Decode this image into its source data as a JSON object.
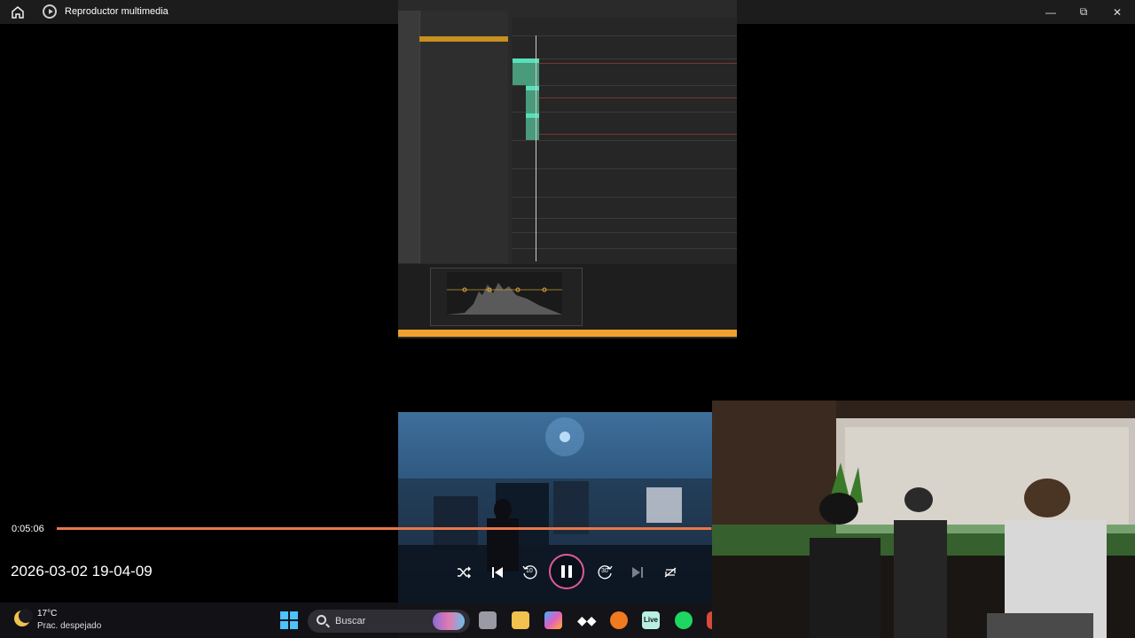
{
  "window": {
    "title": "Reproductor multimedia",
    "icons": {
      "home": "home-icon",
      "app": "media-player-icon",
      "minimize": "minimize-icon",
      "maximize": "maximize-icon",
      "close": "close-icon"
    }
  },
  "player": {
    "current_time": "0:05:06",
    "progress_fraction": 0.997,
    "file_name": "2026-03-02 19-04-09",
    "controls": [
      "shuffle",
      "previous",
      "rewind-10",
      "pause",
      "forward-30",
      "next",
      "repeat"
    ],
    "rewind_label": "10",
    "forward_label": "30",
    "accent_color": "#e8784a"
  },
  "taskbar": {
    "weather": {
      "temperature": "17°C",
      "condition": "Prac. despejado"
    },
    "search_placeholder": "Buscar",
    "apps": [
      "start",
      "search",
      "copilot",
      "task-view",
      "file-explorer",
      "copilot-app",
      "tidal",
      "fl-studio",
      "ableton-live",
      "spotify",
      "chrome"
    ],
    "live_label": "Live"
  }
}
